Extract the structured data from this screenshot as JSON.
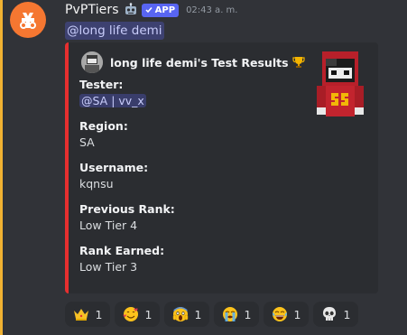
{
  "message": {
    "username": "PvPTiers",
    "robot_icon": "robot-icon",
    "app_badge": "APP",
    "timestamp": "02:43 a. m.",
    "mention": "@long life demi"
  },
  "embed": {
    "accent_color": "#e62f2f",
    "author": "long life demi's Test Results",
    "author_icon": "trophy-icon",
    "fields": [
      {
        "name": "Tester:",
        "value": "@SA | vv_x"
      },
      {
        "name": "Region:",
        "value": "SA"
      },
      {
        "name": "Username:",
        "value": "kqnsu"
      },
      {
        "name": "Previous Rank:",
        "value": "Low Tier 4"
      },
      {
        "name": "Rank Earned:",
        "value": "Low Tier 3"
      }
    ]
  },
  "reactions": [
    {
      "emoji": "crown-emoji",
      "count": "1"
    },
    {
      "emoji": "smiling-face-with-hearts-emoji",
      "count": "1"
    },
    {
      "emoji": "screaming-face-emoji",
      "count": "1"
    },
    {
      "emoji": "loudly-crying-face-emoji",
      "count": "1"
    },
    {
      "emoji": "tears-of-joy-emoji",
      "count": "1"
    },
    {
      "emoji": "skull-emoji",
      "count": "1"
    }
  ],
  "colors": {
    "background": "#313338",
    "embed_background": "#2b2d31",
    "brand": "#5865f2",
    "highlight_bar": "#f0b232"
  }
}
